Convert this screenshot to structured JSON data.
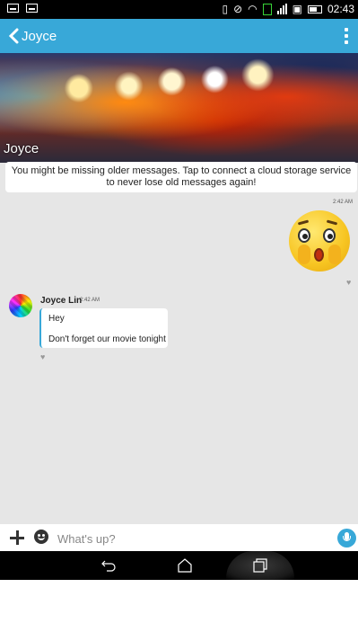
{
  "status_bar": {
    "time": "02:43",
    "icons": [
      "image-icon",
      "gallery-icon",
      "vibrate-icon",
      "mute-icon",
      "wifi-icon",
      "sim1-icon",
      "signal-icon",
      "sim2-icon",
      "signal2-icon",
      "battery-icon"
    ]
  },
  "app_bar": {
    "title": "Joyce",
    "back_icon": "chevron-left-icon",
    "menu_icon": "overflow-menu-icon",
    "color": "#38a8d8"
  },
  "cover": {
    "name": "Joyce"
  },
  "notice": {
    "text": "You might be missing older messages. Tap to connect a cloud storage service to never lose old messages again!"
  },
  "messages": {
    "outgoing": {
      "time": "2:42 AM",
      "content": "shocked-emoji-sticker"
    },
    "incoming": {
      "sender": "Joyce Lin",
      "time": "2:42 AM",
      "lines": [
        "Hey",
        "Don't forget our movie tonight"
      ]
    }
  },
  "input": {
    "placeholder": "What's up?",
    "value": ""
  },
  "nav_bar": {
    "icons": [
      "back-icon",
      "home-icon",
      "recents-icon"
    ]
  }
}
